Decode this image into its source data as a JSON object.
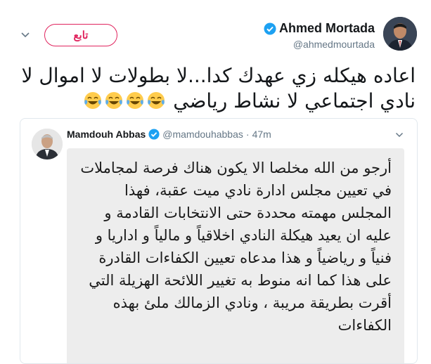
{
  "tweet": {
    "author_name": "Ahmed Mortada",
    "author_handle": "@ahmedmourtada",
    "follow_label": "تابع",
    "text": "اعاده هيكله زي عهدك كدا...لا بطولات لا اموال لا نادي اجتماعي لا نشاط رياضي",
    "emoji": [
      "face-with-tears-of-joy-icon",
      "face-with-tears-of-joy-icon",
      "face-with-tears-of-joy-icon",
      "face-with-tears-of-joy-icon"
    ]
  },
  "quoted_tweet": {
    "author_name": "Mamdouh Abbas",
    "author_handle": "@mamdouhabbas",
    "separator": "·",
    "time": "47m",
    "image_text": "أرجو من الله مخلصا الا يكون هناك فرصة لمجاملات في تعيين مجلس ادارة نادي ميت عقبة، فهذا المجلس مهمته محددة حتى الانتخابات القادمة و عليه ان يعيد هيكلة النادي اخلاقياً و مالياً و اداريا و فنياً و رياضياً و هذا مدعاه تعيين الكفاءات القادرة على هذا كما انه منوط به تغيير اللائحة الهزيلة التي أقرت بطريقة مريبة ، ونادي الزمالك ملئ بهذه الكفاءات"
  },
  "colors": {
    "follow": "#e0245e",
    "verified": "#1da1f2",
    "secondary_text": "#657786",
    "border": "#e1e8ed"
  }
}
